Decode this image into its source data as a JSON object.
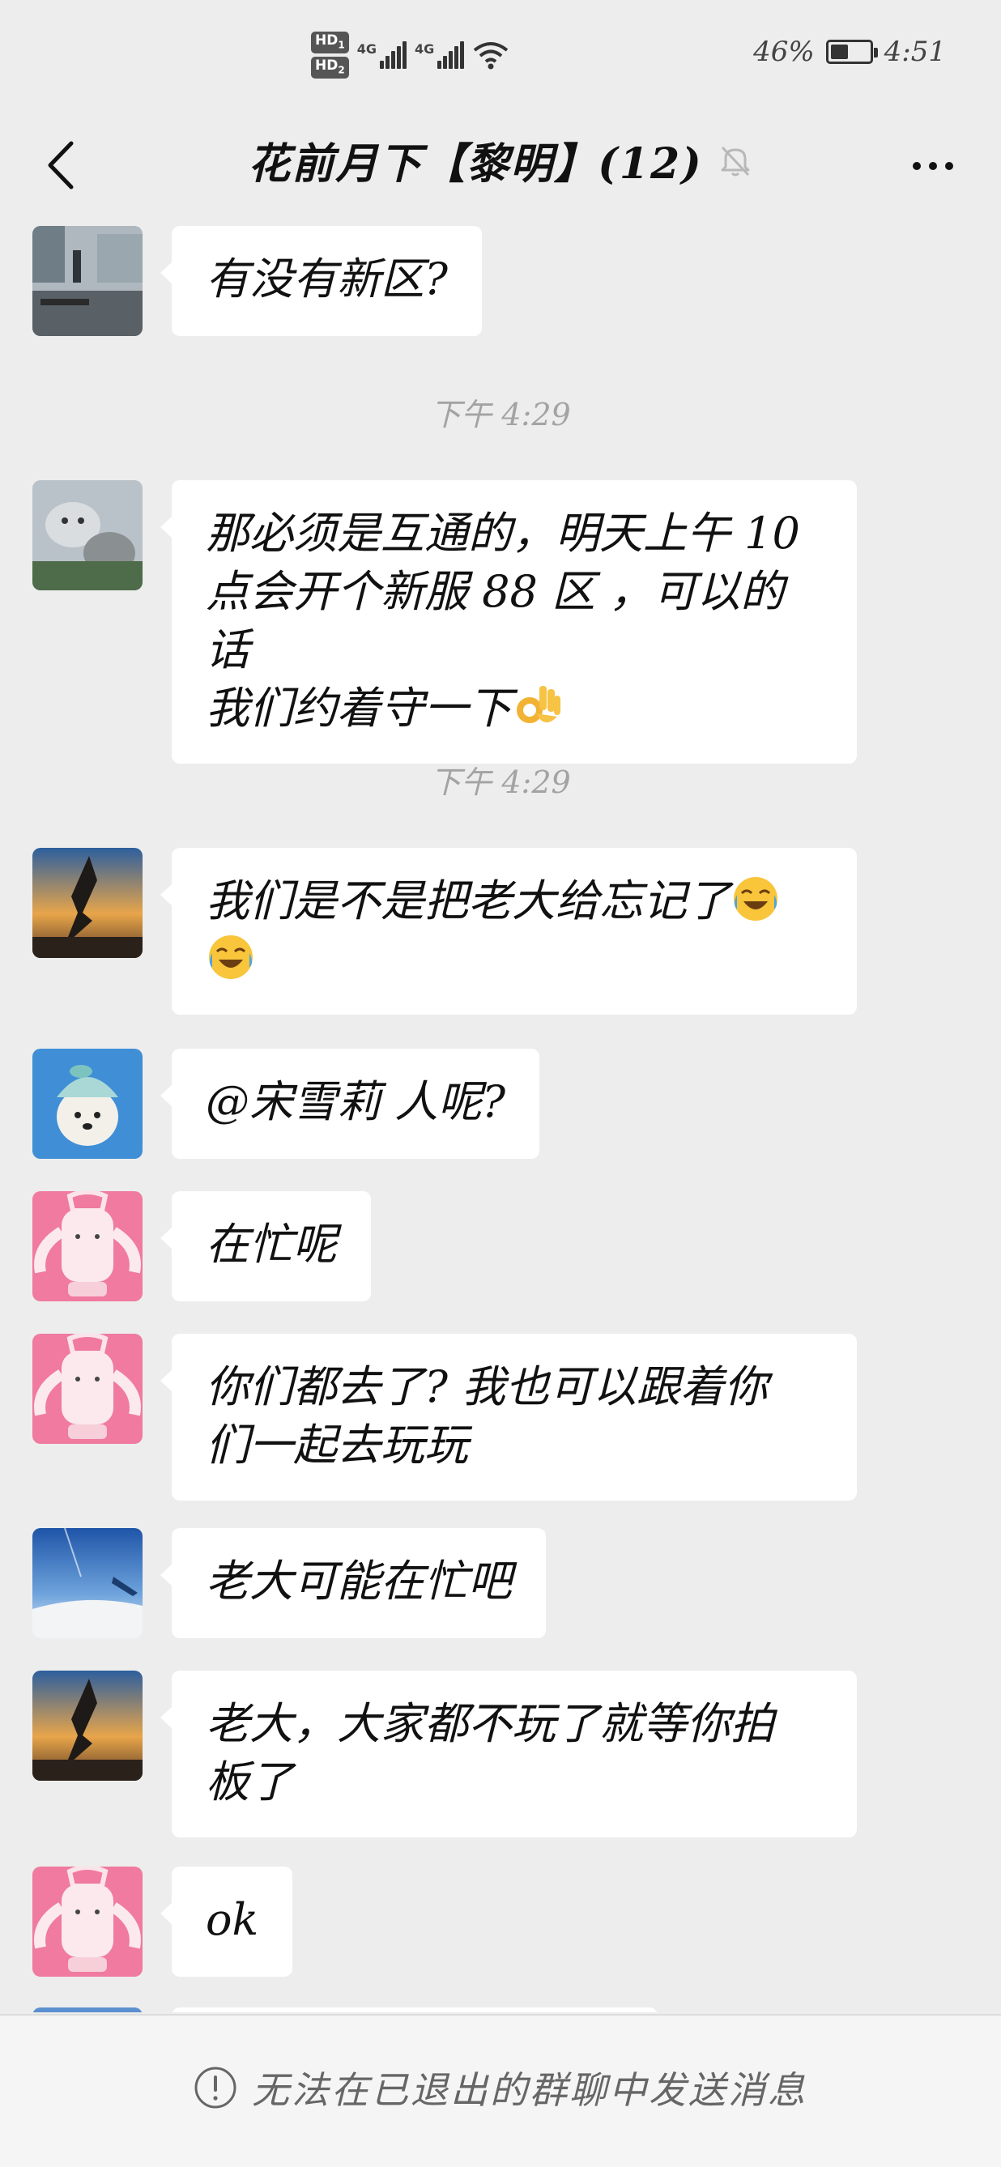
{
  "status_bar": {
    "hd1": "HD",
    "hd1_sub": "1",
    "hd2": "HD",
    "hd2_sub": "2",
    "net1": "4G",
    "net2": "4G",
    "battery_level": 0.46,
    "battery_percent": "46%",
    "time": "4:51"
  },
  "header": {
    "title": "花前月下【黎明】(12)",
    "back_icon": "chevron-left-icon",
    "mute_icon": "bell-off-icon",
    "more_icon": "more-dots-icon"
  },
  "messages": [
    {
      "type": "text",
      "avatar": "building-photo-avatar",
      "text": "有没有新区?"
    },
    {
      "type": "time",
      "text": "下午 4:29"
    },
    {
      "type": "text",
      "avatar": "cat-photo-avatar",
      "lines": [
        "那必须是互通的，明天上午 10",
        "点会开个新服 88 区 ，可以的话",
        "我们约着守一下"
      ],
      "emoji": "ok-hand-emoji"
    },
    {
      "type": "time",
      "text": "下午 4:29"
    },
    {
      "type": "text",
      "avatar": "eagle-sunset-avatar",
      "lines": [
        "我们是不是把老大给忘记了"
      ],
      "emoji": "laughing-crying-emoji"
    },
    {
      "type": "text",
      "avatar": "dog-hat-avatar",
      "text": "@宋雪莉  人呢?"
    },
    {
      "type": "text",
      "avatar": "pink-bunny-avatar",
      "text": "在忙呢"
    },
    {
      "type": "text",
      "avatar": "pink-bunny-avatar",
      "lines": [
        "你们都去了? 我也可以跟着你",
        "们一起去玩玩"
      ]
    },
    {
      "type": "text",
      "avatar": "airplane-sky-avatar",
      "text": "老大可能在忙吧"
    },
    {
      "type": "text",
      "avatar": "eagle-sunset-avatar",
      "lines": [
        "老大，大家都不玩了就等你拍",
        "板了"
      ]
    },
    {
      "type": "text",
      "avatar": "pink-bunny-avatar",
      "text": "ok"
    }
  ],
  "footer": {
    "notice_icon": "exclamation-circle-icon",
    "notice": "无法在已退出的群聊中发送消息"
  }
}
